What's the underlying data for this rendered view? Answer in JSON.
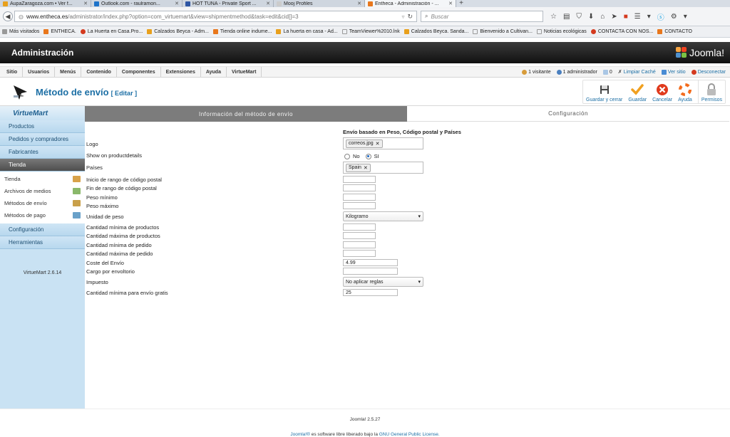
{
  "browser": {
    "tabs": [
      {
        "label": "AupaZaragoza.com • Ver f...",
        "color": "#e8a01c",
        "active": false
      },
      {
        "label": "Outlook.com - raulramon...",
        "color": "#1e73c9",
        "active": false
      },
      {
        "label": "HOT TUNA - Private Sport ...",
        "color": "#2d55a3",
        "active": false
      },
      {
        "label": "Mooj Profiles",
        "color": "#cccccc",
        "active": false
      },
      {
        "label": "Entheca - Administración - ...",
        "color": "#e8771c",
        "active": true
      }
    ],
    "new_tab": "+",
    "url_domain": "www.entheca.es",
    "url_path": "/administrator/index.php?option=com_virtuemart&view=shipmentmethod&task=edit&cid[]=3",
    "search_placeholder": "Buscar"
  },
  "bookmarks": [
    {
      "label": "Más visitados",
      "color": "#999999"
    },
    {
      "label": "ENTHECA.",
      "color": "#e8771c"
    },
    {
      "label": "La Huerta en Casa.Pro...",
      "color": "#d43a1f"
    },
    {
      "label": "Calzados Beyca - Adm...",
      "color": "#e8a01c"
    },
    {
      "label": "Tienda online indume...",
      "color": "#e8771c"
    },
    {
      "label": "La huerta en casa - Ad...",
      "color": "#e8a01c"
    },
    {
      "label": "TeamViewer%2010.lnk",
      "color": "#dddddd"
    },
    {
      "label": "Calzados Beyca. Sanda...",
      "color": "#e8a01c"
    },
    {
      "label": "Bienvenido a Cultivan...",
      "color": "#dddddd"
    },
    {
      "label": "Noticias ecológicas",
      "color": "#dddddd"
    },
    {
      "label": "CONTACTA CON NOS...",
      "color": "#d43a1f"
    },
    {
      "label": "CONTACTO",
      "color": "#e8771c"
    }
  ],
  "header": {
    "title": "Administración",
    "brand": "Joomla!"
  },
  "menu": {
    "items": [
      "Sitio",
      "Usuarios",
      "Menús",
      "Contenido",
      "Componentes",
      "Extensiones",
      "Ayuda",
      "VirtueMart"
    ],
    "visitors": "1 visitante",
    "admins": "1 administrador",
    "messages": "0",
    "clear_cache": "Limpiar Caché",
    "view_site": "Ver sitio",
    "logout": "Desconectar"
  },
  "toolbar": {
    "title": "Método de envío",
    "edit": "[ Editar ]",
    "buttons": {
      "save_close": "Guardar y cerrar",
      "save": "Guardar",
      "cancel": "Cancelar",
      "help": "Ayuda",
      "permissions": "Permisos"
    }
  },
  "sidebar": {
    "logo": "VirtueMart",
    "groups": {
      "products": "Productos",
      "orders": "Pedidos y compradores",
      "manufacturers": "Fabricantes",
      "shop": "Tienda",
      "config": "Configuración",
      "tools": "Herramientas"
    },
    "shop_items": [
      {
        "label": "Tienda",
        "color": "#d8a24a"
      },
      {
        "label": "Archivos de medios",
        "color": "#8ab86a"
      },
      {
        "label": "Métodos de envío",
        "color": "#c9a04a"
      },
      {
        "label": "Métodos de pago",
        "color": "#6aa1c9"
      }
    ],
    "version": "VirtueMart 2.6.14"
  },
  "content_tabs": {
    "info": "Información del método de envío",
    "config": "Configuración"
  },
  "form": {
    "section_title": "Envío basado en Peso, Código postal y Países",
    "labels": {
      "logo": "Logo",
      "show_details": "Show on productdetails",
      "countries": "Países",
      "zip_start": "Inicio de rango de código postal",
      "zip_end": "Fin de rango de código postal",
      "weight_min": "Peso mínimo",
      "weight_max": "Peso máximo",
      "weight_unit": "Unidad de peso",
      "products_min": "Cantidad mínima de productos",
      "products_max": "Cantidad máxima de productos",
      "order_min": "Cantidad mínima de pedido",
      "order_max": "Cantidad máxima de pedido",
      "shipment_cost": "Coste del Envío",
      "package_fee": "Cargo por envoltorio",
      "tax": "Impuesto",
      "free_shipment": "Cantidad mínima para envío gratis"
    },
    "values": {
      "logo_chip": "correos.jpg",
      "radio_no": "No",
      "radio_yes": "SI",
      "country_chip": "Spain",
      "zip_start": "",
      "zip_end": "",
      "weight_min": "",
      "weight_max": "",
      "weight_unit": "Kilogramo",
      "products_min": "",
      "products_max": "",
      "order_min": "",
      "order_max": "",
      "shipment_cost": "4.99",
      "package_fee": "",
      "tax": "No aplicar reglas",
      "free_shipment": "25"
    }
  },
  "footer": {
    "version": "Joomla! 2.5.27",
    "license_brand": "Joomla!®",
    "license_text": " es software libre liberado bajo la ",
    "license_link": "GNU General Public License."
  }
}
